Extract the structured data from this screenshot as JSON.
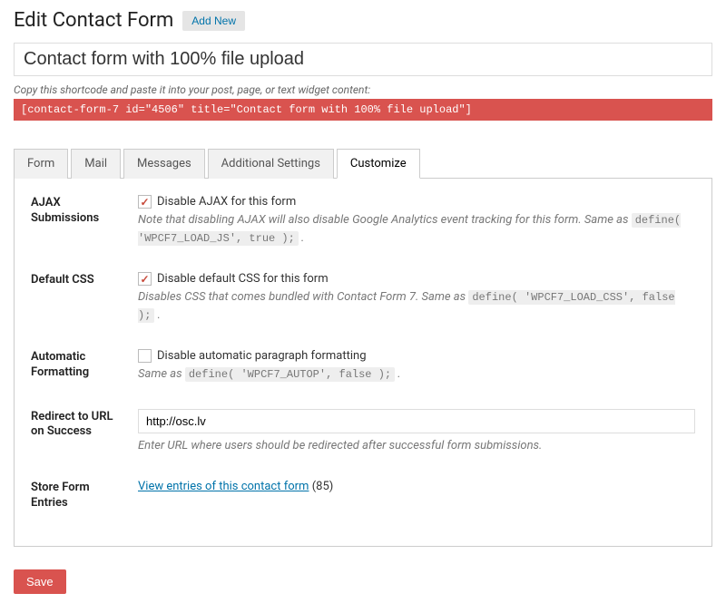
{
  "header": {
    "title": "Edit Contact Form",
    "add_new": "Add New"
  },
  "form_title": "Contact form with 100% file upload",
  "shortcode": {
    "hint": "Copy this shortcode and paste it into your post, page, or text widget content:",
    "code": "[contact-form-7 id=\"4506\" title=\"Contact form with 100% file upload\"]"
  },
  "tabs": [
    "Form",
    "Mail",
    "Messages",
    "Additional Settings",
    "Customize"
  ],
  "settings": {
    "ajax": {
      "label": "AJAX Submissions",
      "checkbox_label": "Disable AJAX for this form",
      "desc_before": "Note that disabling AJAX will also disable Google Analytics event tracking for this form. Same as ",
      "code": "define( 'WPCF7_LOAD_JS', true );",
      "desc_after": " ."
    },
    "css": {
      "label": "Default CSS",
      "checkbox_label": "Disable default CSS for this form",
      "desc_before": "Disables CSS that comes bundled with Contact Form 7. Same as ",
      "code": "define( 'WPCF7_LOAD_CSS', false );",
      "desc_after": " ."
    },
    "autop": {
      "label": "Automatic Formatting",
      "checkbox_label": "Disable automatic paragraph formatting",
      "desc_before": "Same as ",
      "code": "define( 'WPCF7_AUTOP', false );",
      "desc_after": " ."
    },
    "redirect": {
      "label": "Redirect to URL on Success",
      "value": "http://osc.lv",
      "desc": "Enter URL where users should be redirected after successful form submissions."
    },
    "entries": {
      "label": "Store Form Entries",
      "link_text": "View entries of this contact form",
      "count": "(85)"
    }
  },
  "save_button": "Save"
}
